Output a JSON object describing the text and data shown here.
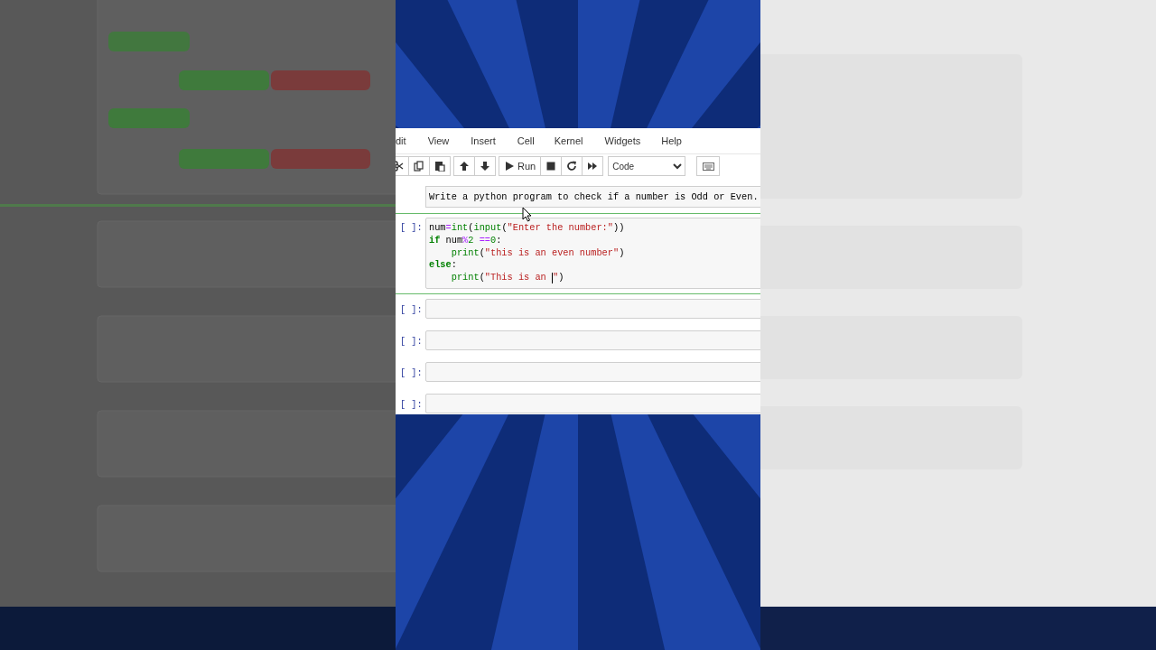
{
  "menu": [
    {
      "label": "dit"
    },
    {
      "label": "View"
    },
    {
      "label": "Insert"
    },
    {
      "label": "Cell"
    },
    {
      "label": "Kernel"
    },
    {
      "label": "Widgets"
    },
    {
      "label": "Help"
    }
  ],
  "toolbar": {
    "groups": [
      [
        {
          "kind": "cut"
        },
        {
          "kind": "copy"
        },
        {
          "kind": "paste"
        }
      ],
      [
        {
          "kind": "up"
        },
        {
          "kind": "down"
        }
      ],
      [
        {
          "kind": "run",
          "label": "Run"
        },
        {
          "kind": "stop"
        },
        {
          "kind": "restart"
        },
        {
          "kind": "fastforward"
        }
      ]
    ],
    "cell_type": "Code"
  },
  "cells": [
    {
      "kind": "markdown",
      "selected": false,
      "text": "Write a python program to check if a number is Odd or Even."
    },
    {
      "kind": "code",
      "selected": true,
      "prompt": "[ ]:",
      "lines": [
        [
          {
            "kind": "name",
            "text": "num"
          },
          {
            "kind": "op",
            "text": "="
          },
          {
            "kind": "builtin",
            "text": "int"
          },
          {
            "kind": "plain",
            "text": "("
          },
          {
            "kind": "builtin",
            "text": "input"
          },
          {
            "kind": "plain",
            "text": "("
          },
          {
            "kind": "string",
            "text": "\"Enter the number:\""
          },
          {
            "kind": "plain",
            "text": "))"
          }
        ],
        [
          {
            "kind": "keyword",
            "text": "if"
          },
          {
            "kind": "name",
            "text": " num"
          },
          {
            "kind": "op",
            "text": "%"
          },
          {
            "kind": "number",
            "text": "2"
          },
          {
            "kind": "op",
            "text": " =="
          },
          {
            "kind": "number",
            "text": "0"
          },
          {
            "kind": "plain",
            "text": ":"
          }
        ],
        [
          {
            "kind": "builtin",
            "text": "    print"
          },
          {
            "kind": "plain",
            "text": "("
          },
          {
            "kind": "string",
            "text": "\"this is an even number\""
          },
          {
            "kind": "plain",
            "text": ")"
          }
        ],
        [
          {
            "kind": "keyword",
            "text": "else"
          },
          {
            "kind": "plain",
            "text": ":"
          }
        ],
        [
          {
            "kind": "builtin",
            "text": "    print"
          },
          {
            "kind": "plain",
            "text": "("
          },
          {
            "kind": "string",
            "text": "\"This is an "
          },
          {
            "kind": "cursor"
          },
          {
            "kind": "string",
            "text": "\""
          },
          {
            "kind": "plain",
            "text": ")"
          }
        ]
      ]
    },
    {
      "kind": "code",
      "selected": false,
      "prompt": "[ ]:"
    },
    {
      "kind": "code",
      "selected": false,
      "prompt": "[ ]:"
    },
    {
      "kind": "code",
      "selected": false,
      "prompt": "[ ]:"
    },
    {
      "kind": "code",
      "selected": false,
      "prompt": "[ ]:"
    }
  ]
}
